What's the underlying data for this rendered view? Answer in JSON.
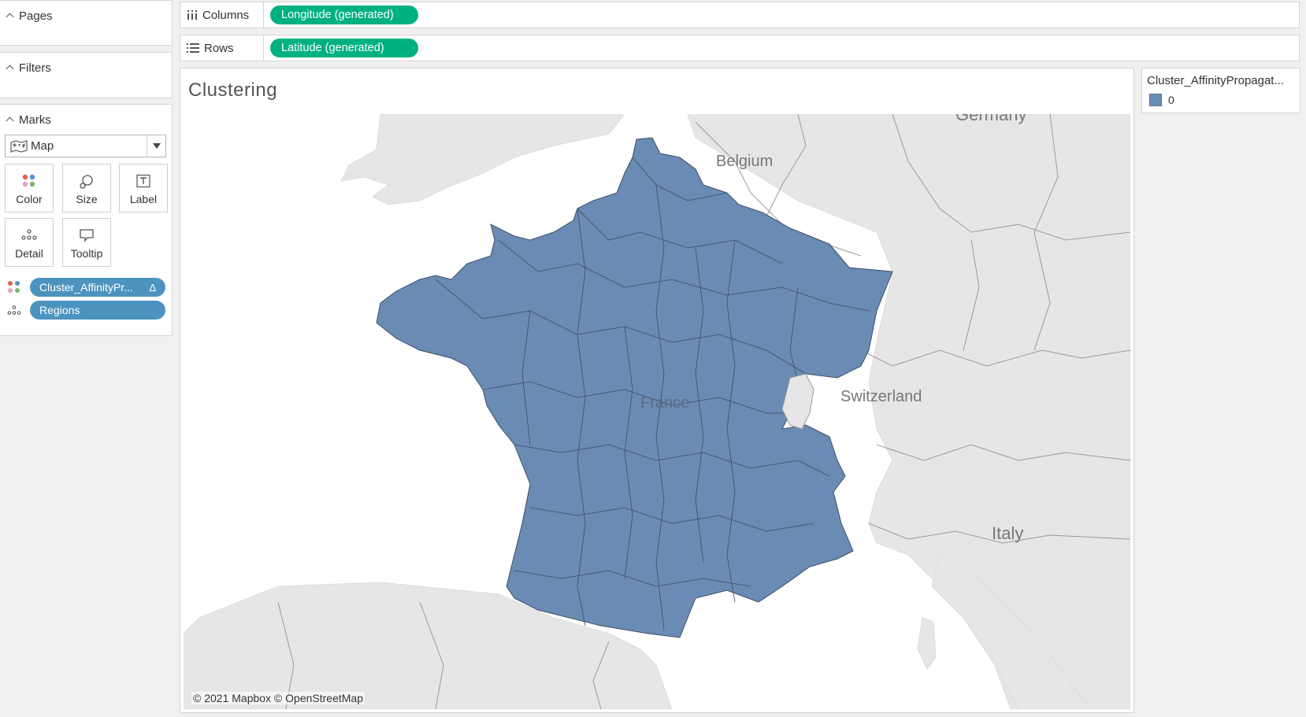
{
  "sidebar": {
    "pages_label": "Pages",
    "filters_label": "Filters",
    "marks_label": "Marks",
    "mark_type": "Map",
    "buttons": {
      "color": "Color",
      "size": "Size",
      "label": "Label",
      "detail": "Detail",
      "tooltip": "Tooltip"
    },
    "pills": {
      "color_field": "Cluster_AffinityPr...",
      "color_field_suffix": "Δ",
      "detail_field": "Regions"
    }
  },
  "shelves": {
    "columns_label": "Columns",
    "columns_pill": "Longitude (generated)",
    "rows_label": "Rows",
    "rows_pill": "Latitude (generated)"
  },
  "worksheet": {
    "title": "Clustering",
    "attribution": "© 2021 Mapbox  © OpenStreetMap",
    "map_labels": {
      "germany": "Germany",
      "belgium": "Belgium",
      "switzerland": "Switzerland",
      "france": "France",
      "italy": "Italy"
    }
  },
  "legend": {
    "title": "Cluster_AffinityPropagat...",
    "items": [
      {
        "label": "0",
        "color": "#6a8bb3"
      }
    ]
  },
  "colors": {
    "mark_fill": "#6a8bb3",
    "shelf_pill": "#00b180",
    "marks_pill": "#4c94bf",
    "land": "#e6e6e6",
    "water": "#ffffff"
  }
}
